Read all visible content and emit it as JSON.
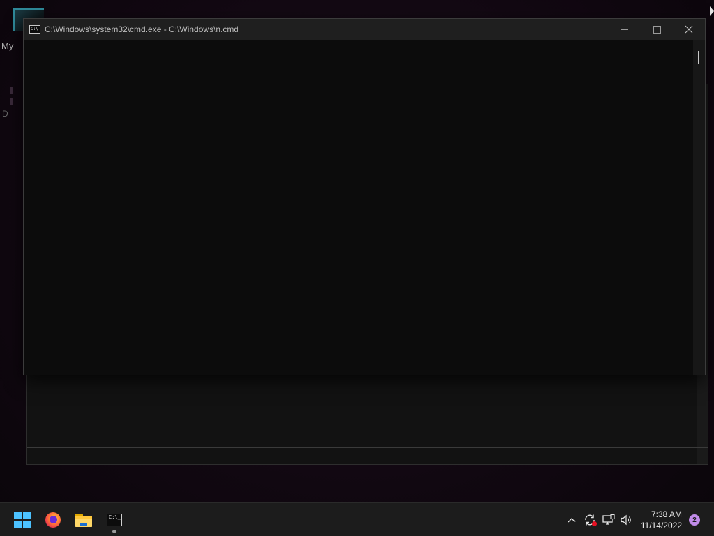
{
  "desktop": {
    "label_top": "My",
    "label_mid": "D"
  },
  "cmd_window": {
    "title": "C:\\Windows\\system32\\cmd.exe - C:\\Windows\\n.cmd",
    "icon_text": "C:\\",
    "controls": {
      "minimize_icon": "minimize-icon",
      "maximize_icon": "maximize-icon",
      "close_icon": "close-icon"
    }
  },
  "taskbar": {
    "apps": [
      {
        "name": "start",
        "icon": "windows-logo-icon"
      },
      {
        "name": "firefox",
        "icon": "firefox-icon"
      },
      {
        "name": "file-explorer",
        "icon": "folder-icon"
      },
      {
        "name": "command-prompt",
        "icon": "terminal-icon",
        "running": true
      }
    ],
    "term_icon_text": "C:\\_",
    "tray": {
      "chevron": "^",
      "icons": [
        "update-sync-icon",
        "network-icon",
        "volume-icon"
      ]
    },
    "clock": {
      "time": "7:38 AM",
      "date": "11/14/2022"
    },
    "notification_count": "2"
  },
  "colors": {
    "accent": "#4cc2ff",
    "notification": "#c08be8",
    "alert": "#e81123"
  }
}
